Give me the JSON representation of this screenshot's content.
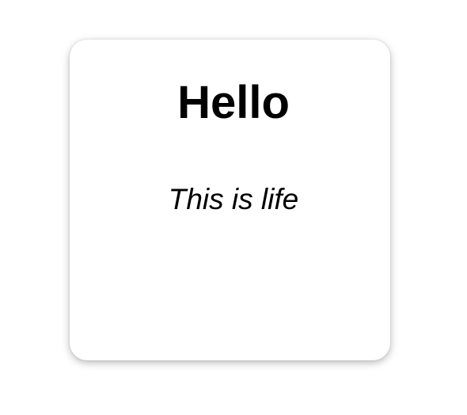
{
  "card": {
    "title": "Hello",
    "subtitle": "This is life"
  },
  "colors": {
    "background": "#ffffff",
    "card_background": "#ffffff",
    "text": "#000000"
  }
}
